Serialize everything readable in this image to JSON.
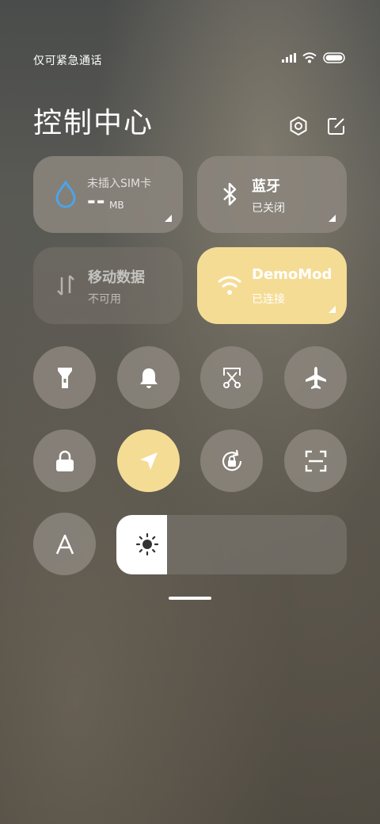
{
  "status_bar": {
    "carrier_text": "仅可紧急通话",
    "signal_icon": "signal-icon",
    "wifi_icon": "wifi-icon",
    "battery_icon": "battery-icon"
  },
  "header": {
    "title": "控制中心",
    "settings_icon": "settings-icon",
    "edit_icon": "edit-icon"
  },
  "tiles": {
    "data_usage": {
      "label": "未插入SIM卡",
      "value": "--",
      "unit": "MB",
      "icon": "water-drop-icon",
      "accent": "#4da3e8"
    },
    "bluetooth": {
      "title": "蓝牙",
      "status": "已关闭",
      "icon": "bluetooth-icon"
    },
    "mobile_data": {
      "title": "移动数据",
      "status": "不可用",
      "icon": "data-arrows-icon"
    },
    "wifi": {
      "title": "DemoMode",
      "status": "已连接",
      "icon": "wifi-icon",
      "active_color": "#f5dc95"
    }
  },
  "toggles": [
    {
      "name": "flashlight",
      "icon": "flashlight-icon",
      "on": false
    },
    {
      "name": "ringer",
      "icon": "bell-icon",
      "on": false
    },
    {
      "name": "screenshot",
      "icon": "scissors-icon",
      "on": false
    },
    {
      "name": "airplane-mode",
      "icon": "airplane-icon",
      "on": false
    },
    {
      "name": "lock-screen",
      "icon": "lock-icon",
      "on": false
    },
    {
      "name": "location",
      "icon": "location-arrow-icon",
      "on": true
    },
    {
      "name": "rotation-lock",
      "icon": "rotation-lock-icon",
      "on": false
    },
    {
      "name": "scanner",
      "icon": "scan-icon",
      "on": false
    },
    {
      "name": "reading-mode",
      "icon": "font-a-icon",
      "on": false
    }
  ],
  "brightness": {
    "level": 0.22,
    "icon": "sun-icon"
  }
}
